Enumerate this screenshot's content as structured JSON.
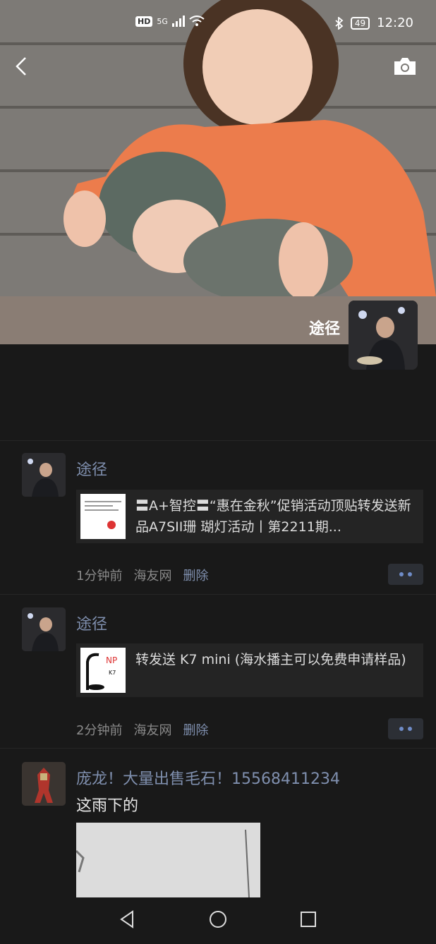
{
  "status_bar": {
    "hd": "HD",
    "network": "5G",
    "battery": "49",
    "time": "12:20"
  },
  "header": {
    "owner_name": "途径"
  },
  "posts": [
    {
      "author": "途径",
      "share_title": "〓A+智控〓“惠在金秋”促销活动顶贴转发送新品A7SII珊 瑚灯活动丨第2211期...",
      "time": "1分钟前",
      "source": "海友网",
      "delete": "删除"
    },
    {
      "author": "途径",
      "share_title": "转发送 K7 mini (海水播主可以免费申请样品)",
      "time": "2分钟前",
      "source": "海友网",
      "delete": "删除"
    },
    {
      "author": "庞龙！大量出售毛石！15568411234",
      "body": "这雨下的"
    }
  ],
  "colors": {
    "background": "#191919",
    "name_link": "#7f8fae",
    "more_dots": "#6f8cc8"
  }
}
